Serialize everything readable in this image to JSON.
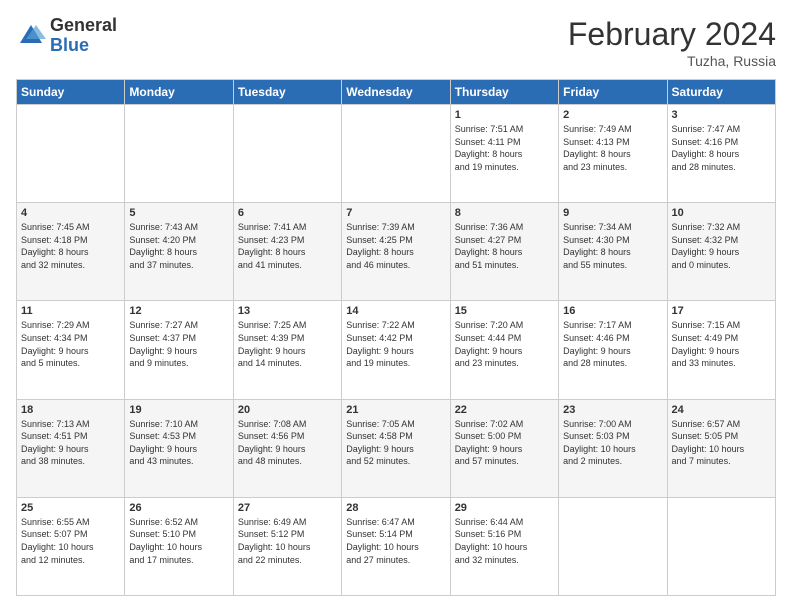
{
  "logo": {
    "general": "General",
    "blue": "Blue"
  },
  "title": "February 2024",
  "subtitle": "Tuzha, Russia",
  "header_days": [
    "Sunday",
    "Monday",
    "Tuesday",
    "Wednesday",
    "Thursday",
    "Friday",
    "Saturday"
  ],
  "weeks": [
    [
      {
        "day": "",
        "info": ""
      },
      {
        "day": "",
        "info": ""
      },
      {
        "day": "",
        "info": ""
      },
      {
        "day": "",
        "info": ""
      },
      {
        "day": "1",
        "info": "Sunrise: 7:51 AM\nSunset: 4:11 PM\nDaylight: 8 hours\nand 19 minutes."
      },
      {
        "day": "2",
        "info": "Sunrise: 7:49 AM\nSunset: 4:13 PM\nDaylight: 8 hours\nand 23 minutes."
      },
      {
        "day": "3",
        "info": "Sunrise: 7:47 AM\nSunset: 4:16 PM\nDaylight: 8 hours\nand 28 minutes."
      }
    ],
    [
      {
        "day": "4",
        "info": "Sunrise: 7:45 AM\nSunset: 4:18 PM\nDaylight: 8 hours\nand 32 minutes."
      },
      {
        "day": "5",
        "info": "Sunrise: 7:43 AM\nSunset: 4:20 PM\nDaylight: 8 hours\nand 37 minutes."
      },
      {
        "day": "6",
        "info": "Sunrise: 7:41 AM\nSunset: 4:23 PM\nDaylight: 8 hours\nand 41 minutes."
      },
      {
        "day": "7",
        "info": "Sunrise: 7:39 AM\nSunset: 4:25 PM\nDaylight: 8 hours\nand 46 minutes."
      },
      {
        "day": "8",
        "info": "Sunrise: 7:36 AM\nSunset: 4:27 PM\nDaylight: 8 hours\nand 51 minutes."
      },
      {
        "day": "9",
        "info": "Sunrise: 7:34 AM\nSunset: 4:30 PM\nDaylight: 8 hours\nand 55 minutes."
      },
      {
        "day": "10",
        "info": "Sunrise: 7:32 AM\nSunset: 4:32 PM\nDaylight: 9 hours\nand 0 minutes."
      }
    ],
    [
      {
        "day": "11",
        "info": "Sunrise: 7:29 AM\nSunset: 4:34 PM\nDaylight: 9 hours\nand 5 minutes."
      },
      {
        "day": "12",
        "info": "Sunrise: 7:27 AM\nSunset: 4:37 PM\nDaylight: 9 hours\nand 9 minutes."
      },
      {
        "day": "13",
        "info": "Sunrise: 7:25 AM\nSunset: 4:39 PM\nDaylight: 9 hours\nand 14 minutes."
      },
      {
        "day": "14",
        "info": "Sunrise: 7:22 AM\nSunset: 4:42 PM\nDaylight: 9 hours\nand 19 minutes."
      },
      {
        "day": "15",
        "info": "Sunrise: 7:20 AM\nSunset: 4:44 PM\nDaylight: 9 hours\nand 23 minutes."
      },
      {
        "day": "16",
        "info": "Sunrise: 7:17 AM\nSunset: 4:46 PM\nDaylight: 9 hours\nand 28 minutes."
      },
      {
        "day": "17",
        "info": "Sunrise: 7:15 AM\nSunset: 4:49 PM\nDaylight: 9 hours\nand 33 minutes."
      }
    ],
    [
      {
        "day": "18",
        "info": "Sunrise: 7:13 AM\nSunset: 4:51 PM\nDaylight: 9 hours\nand 38 minutes."
      },
      {
        "day": "19",
        "info": "Sunrise: 7:10 AM\nSunset: 4:53 PM\nDaylight: 9 hours\nand 43 minutes."
      },
      {
        "day": "20",
        "info": "Sunrise: 7:08 AM\nSunset: 4:56 PM\nDaylight: 9 hours\nand 48 minutes."
      },
      {
        "day": "21",
        "info": "Sunrise: 7:05 AM\nSunset: 4:58 PM\nDaylight: 9 hours\nand 52 minutes."
      },
      {
        "day": "22",
        "info": "Sunrise: 7:02 AM\nSunset: 5:00 PM\nDaylight: 9 hours\nand 57 minutes."
      },
      {
        "day": "23",
        "info": "Sunrise: 7:00 AM\nSunset: 5:03 PM\nDaylight: 10 hours\nand 2 minutes."
      },
      {
        "day": "24",
        "info": "Sunrise: 6:57 AM\nSunset: 5:05 PM\nDaylight: 10 hours\nand 7 minutes."
      }
    ],
    [
      {
        "day": "25",
        "info": "Sunrise: 6:55 AM\nSunset: 5:07 PM\nDaylight: 10 hours\nand 12 minutes."
      },
      {
        "day": "26",
        "info": "Sunrise: 6:52 AM\nSunset: 5:10 PM\nDaylight: 10 hours\nand 17 minutes."
      },
      {
        "day": "27",
        "info": "Sunrise: 6:49 AM\nSunset: 5:12 PM\nDaylight: 10 hours\nand 22 minutes."
      },
      {
        "day": "28",
        "info": "Sunrise: 6:47 AM\nSunset: 5:14 PM\nDaylight: 10 hours\nand 27 minutes."
      },
      {
        "day": "29",
        "info": "Sunrise: 6:44 AM\nSunset: 5:16 PM\nDaylight: 10 hours\nand 32 minutes."
      },
      {
        "day": "",
        "info": ""
      },
      {
        "day": "",
        "info": ""
      }
    ]
  ]
}
